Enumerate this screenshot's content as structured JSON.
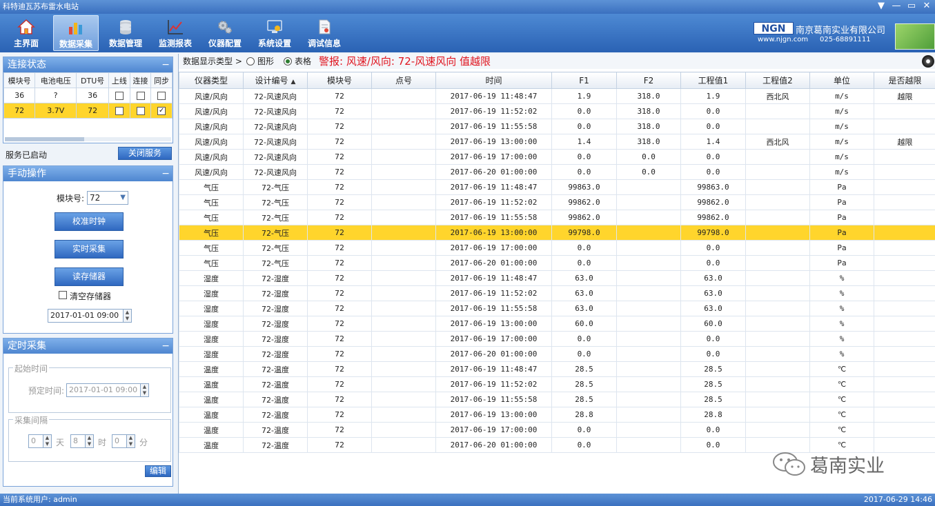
{
  "window": {
    "title": "科特迪瓦苏布雷水电站",
    "controls": [
      "▼",
      "—",
      "▭",
      "✕"
    ]
  },
  "toolbar": {
    "items": [
      {
        "label": "主界面",
        "icon": "home-icon"
      },
      {
        "label": "数据采集",
        "icon": "bar-chart-icon",
        "active": true
      },
      {
        "label": "数据管理",
        "icon": "database-icon"
      },
      {
        "label": "监测报表",
        "icon": "line-chart-icon"
      },
      {
        "label": "仪器配置",
        "icon": "gear-icon"
      },
      {
        "label": "系统设置",
        "icon": "monitor-settings-icon"
      },
      {
        "label": "调试信息",
        "icon": "document-icon"
      }
    ]
  },
  "brand": {
    "logo": "NGN",
    "name": "南京葛南实业有限公司",
    "website": "www.njgn.com",
    "phone": "025-68891111"
  },
  "connection": {
    "title": "连接状态",
    "columns": [
      "模块号",
      "电池电压",
      "DTU号",
      "上线",
      "连接",
      "同步"
    ],
    "rows": [
      {
        "module": "36",
        "voltage": "?",
        "dtu": "36",
        "online": false,
        "connected": false,
        "sync": false
      },
      {
        "module": "72",
        "voltage": "3.7V",
        "dtu": "72",
        "online": false,
        "connected": false,
        "sync": true
      }
    ]
  },
  "service": {
    "status": "服务已启动",
    "close_label": "关闭服务"
  },
  "manual": {
    "title": "手动操作",
    "module_label": "模块号:",
    "module_value": "72",
    "calibrate_label": "校准时钟",
    "realtime_label": "实时采集",
    "read_storage_label": "读存储器",
    "clear_storage_label": "清空存储器",
    "datetime_value": "2017-01-01 09:00"
  },
  "timer": {
    "title": "定时采集",
    "start_group": "起始时间",
    "scheduled_label": "预定时间:",
    "scheduled_value": "2017-01-01 09:00",
    "interval_group": "采集间隔",
    "days_value": "0",
    "days_unit": "天",
    "hours_value": "8",
    "hours_unit": "时",
    "minutes_value": "0",
    "minutes_unit": "分",
    "edit_label": "编辑"
  },
  "display": {
    "type_label": "数据显示类型 >",
    "graph_label": "图形",
    "table_label": "表格",
    "selected": "table",
    "alarm": "警报: 风速/风向: 72-风速风向 值越限"
  },
  "grid": {
    "columns": [
      "仪器类型",
      "设计编号",
      "模块号",
      "点号",
      "时间",
      "F1",
      "F2",
      "工程值1",
      "工程值2",
      "单位",
      "是否越限"
    ],
    "sort_column_arrow": "▲",
    "selected_row": 9,
    "rows": [
      [
        "风速/风向",
        "72-风速风向",
        "72",
        "",
        "2017-06-19 11:48:47",
        "1.9",
        "318.0",
        "1.9",
        "西北风",
        "m/s",
        "越限"
      ],
      [
        "风速/风向",
        "72-风速风向",
        "72",
        "",
        "2017-06-19 11:52:02",
        "0.0",
        "318.0",
        "0.0",
        "",
        "m/s",
        ""
      ],
      [
        "风速/风向",
        "72-风速风向",
        "72",
        "",
        "2017-06-19 11:55:58",
        "0.0",
        "318.0",
        "0.0",
        "",
        "m/s",
        ""
      ],
      [
        "风速/风向",
        "72-风速风向",
        "72",
        "",
        "2017-06-19 13:00:00",
        "1.4",
        "318.0",
        "1.4",
        "西北风",
        "m/s",
        "越限"
      ],
      [
        "风速/风向",
        "72-风速风向",
        "72",
        "",
        "2017-06-19 17:00:00",
        "0.0",
        "0.0",
        "0.0",
        "",
        "m/s",
        ""
      ],
      [
        "风速/风向",
        "72-风速风向",
        "72",
        "",
        "2017-06-20 01:00:00",
        "0.0",
        "0.0",
        "0.0",
        "",
        "m/s",
        ""
      ],
      [
        "气压",
        "72-气压",
        "72",
        "",
        "2017-06-19 11:48:47",
        "99863.0",
        "",
        "99863.0",
        "",
        "Pa",
        ""
      ],
      [
        "气压",
        "72-气压",
        "72",
        "",
        "2017-06-19 11:52:02",
        "99862.0",
        "",
        "99862.0",
        "",
        "Pa",
        ""
      ],
      [
        "气压",
        "72-气压",
        "72",
        "",
        "2017-06-19 11:55:58",
        "99862.0",
        "",
        "99862.0",
        "",
        "Pa",
        ""
      ],
      [
        "气压",
        "72-气压",
        "72",
        "",
        "2017-06-19 13:00:00",
        "99798.0",
        "",
        "99798.0",
        "",
        "Pa",
        ""
      ],
      [
        "气压",
        "72-气压",
        "72",
        "",
        "2017-06-19 17:00:00",
        "0.0",
        "",
        "0.0",
        "",
        "Pa",
        ""
      ],
      [
        "气压",
        "72-气压",
        "72",
        "",
        "2017-06-20 01:00:00",
        "0.0",
        "",
        "0.0",
        "",
        "Pa",
        ""
      ],
      [
        "湿度",
        "72-湿度",
        "72",
        "",
        "2017-06-19 11:48:47",
        "63.0",
        "",
        "63.0",
        "",
        "%",
        ""
      ],
      [
        "湿度",
        "72-湿度",
        "72",
        "",
        "2017-06-19 11:52:02",
        "63.0",
        "",
        "63.0",
        "",
        "%",
        ""
      ],
      [
        "湿度",
        "72-湿度",
        "72",
        "",
        "2017-06-19 11:55:58",
        "63.0",
        "",
        "63.0",
        "",
        "%",
        ""
      ],
      [
        "湿度",
        "72-湿度",
        "72",
        "",
        "2017-06-19 13:00:00",
        "60.0",
        "",
        "60.0",
        "",
        "%",
        ""
      ],
      [
        "湿度",
        "72-湿度",
        "72",
        "",
        "2017-06-19 17:00:00",
        "0.0",
        "",
        "0.0",
        "",
        "%",
        ""
      ],
      [
        "湿度",
        "72-湿度",
        "72",
        "",
        "2017-06-20 01:00:00",
        "0.0",
        "",
        "0.0",
        "",
        "%",
        ""
      ],
      [
        "温度",
        "72-温度",
        "72",
        "",
        "2017-06-19 11:48:47",
        "28.5",
        "",
        "28.5",
        "",
        "℃",
        ""
      ],
      [
        "温度",
        "72-温度",
        "72",
        "",
        "2017-06-19 11:52:02",
        "28.5",
        "",
        "28.5",
        "",
        "℃",
        ""
      ],
      [
        "温度",
        "72-温度",
        "72",
        "",
        "2017-06-19 11:55:58",
        "28.5",
        "",
        "28.5",
        "",
        "℃",
        ""
      ],
      [
        "温度",
        "72-温度",
        "72",
        "",
        "2017-06-19 13:00:00",
        "28.8",
        "",
        "28.8",
        "",
        "℃",
        ""
      ],
      [
        "温度",
        "72-温度",
        "72",
        "",
        "2017-06-19 17:00:00",
        "0.0",
        "",
        "0.0",
        "",
        "℃",
        ""
      ],
      [
        "温度",
        "72-温度",
        "72",
        "",
        "2017-06-20 01:00:00",
        "0.0",
        "",
        "0.0",
        "",
        "℃",
        ""
      ]
    ]
  },
  "watermark": {
    "text": "葛南实业",
    "icon": "wechat-icon"
  },
  "status_bar": {
    "user": "当前系统用户: admin",
    "time": "2017-06-29 14:46"
  },
  "colors": {
    "accent": "#2f68c0",
    "selection": "#ffd52c",
    "alarm": "#e0141e"
  }
}
